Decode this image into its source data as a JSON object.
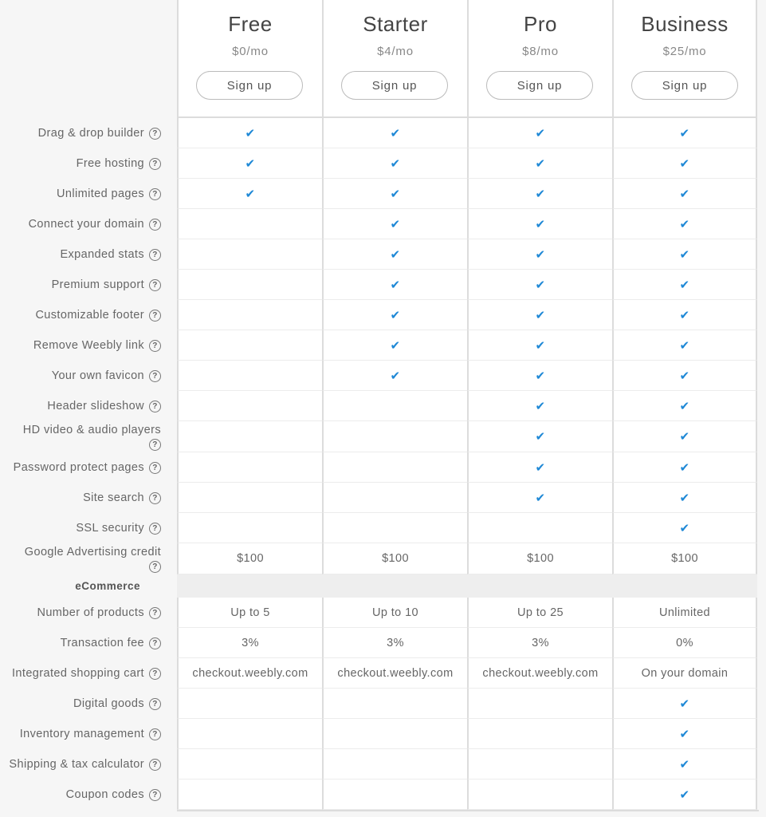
{
  "plans": [
    {
      "name": "Free",
      "price": "$0/mo",
      "signup_label": "Sign up"
    },
    {
      "name": "Starter",
      "price": "$4/mo",
      "signup_label": "Sign up"
    },
    {
      "name": "Pro",
      "price": "$8/mo",
      "signup_label": "Sign up"
    },
    {
      "name": "Business",
      "price": "$25/mo",
      "signup_label": "Sign up"
    }
  ],
  "help_glyph": "?",
  "check_glyph": "✔",
  "check_color": "#1e88d6",
  "features": [
    {
      "label": "Drag & drop builder",
      "values": [
        true,
        true,
        true,
        true
      ]
    },
    {
      "label": "Free hosting",
      "values": [
        true,
        true,
        true,
        true
      ]
    },
    {
      "label": "Unlimited pages",
      "values": [
        true,
        true,
        true,
        true
      ]
    },
    {
      "label": "Connect your domain",
      "values": [
        false,
        true,
        true,
        true
      ]
    },
    {
      "label": "Expanded stats",
      "values": [
        false,
        true,
        true,
        true
      ]
    },
    {
      "label": "Premium support",
      "values": [
        false,
        true,
        true,
        true
      ]
    },
    {
      "label": "Customizable footer",
      "values": [
        false,
        true,
        true,
        true
      ]
    },
    {
      "label": "Remove Weebly link",
      "values": [
        false,
        true,
        true,
        true
      ]
    },
    {
      "label": "Your own favicon",
      "values": [
        false,
        true,
        true,
        true
      ]
    },
    {
      "label": "Header slideshow",
      "values": [
        false,
        false,
        true,
        true
      ]
    },
    {
      "label": "HD video & audio players",
      "values": [
        false,
        false,
        true,
        true
      ],
      "wrap": true
    },
    {
      "label": "Password protect pages",
      "values": [
        false,
        false,
        true,
        true
      ]
    },
    {
      "label": "Site search",
      "values": [
        false,
        false,
        true,
        true
      ]
    },
    {
      "label": "SSL security",
      "values": [
        false,
        false,
        false,
        true
      ]
    },
    {
      "label": "Google Advertising credit",
      "values": [
        "$100",
        "$100",
        "$100",
        "$100"
      ],
      "wrap": true
    }
  ],
  "ecommerce_section": {
    "title": "eCommerce",
    "features": [
      {
        "label": "Number of products",
        "values": [
          "Up to 5",
          "Up to 10",
          "Up to 25",
          "Unlimited"
        ]
      },
      {
        "label": "Transaction fee",
        "values": [
          "3%",
          "3%",
          "3%",
          "0%"
        ]
      },
      {
        "label": "Integrated shopping cart",
        "values": [
          "checkout.weebly.com",
          "checkout.weebly.com",
          "checkout.weebly.com",
          "On your domain"
        ]
      },
      {
        "label": "Digital goods",
        "values": [
          false,
          false,
          false,
          true
        ]
      },
      {
        "label": "Inventory management",
        "values": [
          false,
          false,
          false,
          true
        ]
      },
      {
        "label": "Shipping & tax calculator",
        "values": [
          false,
          false,
          false,
          true
        ]
      },
      {
        "label": "Coupon codes",
        "values": [
          false,
          false,
          false,
          true
        ]
      }
    ]
  }
}
